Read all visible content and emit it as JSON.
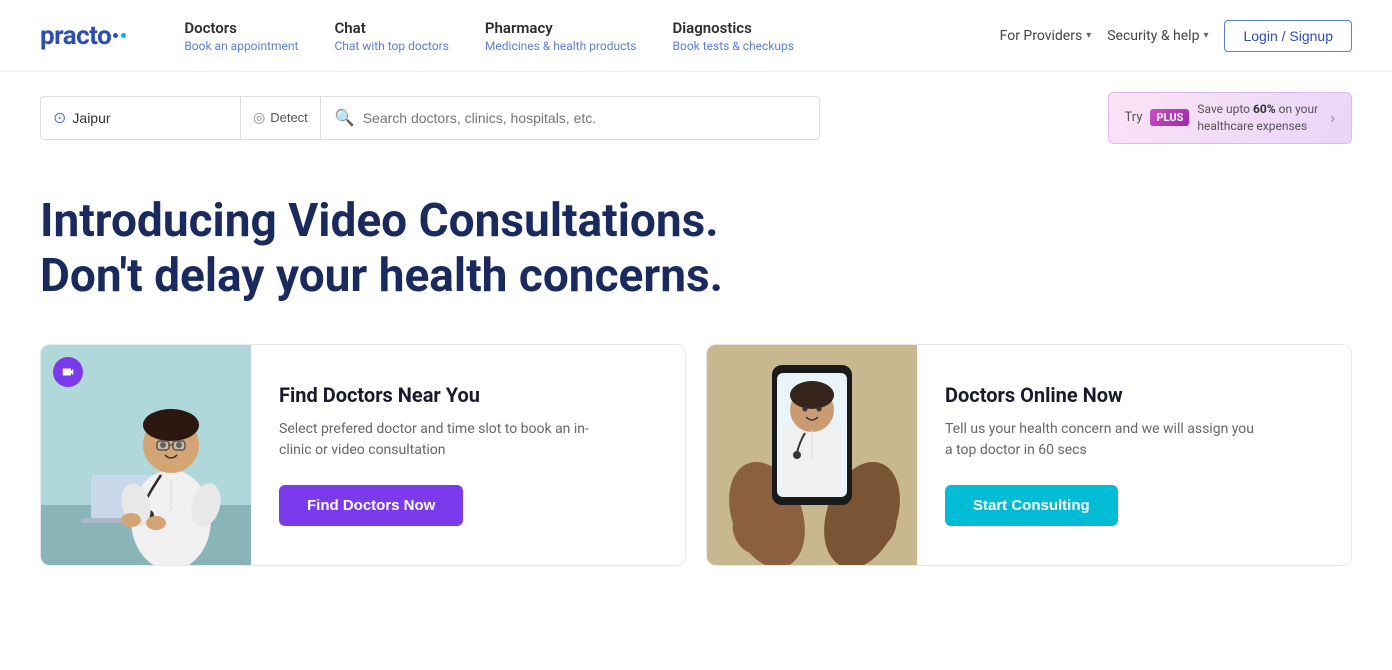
{
  "logo": {
    "text": "practo",
    "aria": "Practo Logo"
  },
  "nav": {
    "items": [
      {
        "id": "doctors",
        "main": "Doctors",
        "sub": "Book an appointment"
      },
      {
        "id": "chat",
        "main": "Chat",
        "sub": "Chat with top doctors"
      },
      {
        "id": "pharmacy",
        "main": "Pharmacy",
        "sub": "Medicines & health products"
      },
      {
        "id": "diagnostics",
        "main": "Diagnostics",
        "sub": "Book tests & checkups"
      }
    ],
    "for_providers_label": "For Providers",
    "security_label": "Security & help",
    "login_label": "Login / Signup"
  },
  "search": {
    "location_value": "Jaipur",
    "detect_label": "Detect",
    "placeholder": "Search doctors, clinics, hospitals, etc."
  },
  "plus": {
    "try_label": "Try",
    "badge_label": "PLUS",
    "desc": "Save upto 60% on your healthcare expenses"
  },
  "hero": {
    "line1": "Introducing Video Consultations.",
    "line2": "Don't delay your health concerns."
  },
  "cards": [
    {
      "id": "find-doctors",
      "title": "Find Doctors Near You",
      "description": "Select prefered doctor and time slot to book an in-clinic or video consultation",
      "button_label": "Find Doctors Now",
      "has_video_badge": true,
      "img_type": "clinic"
    },
    {
      "id": "doctors-online",
      "title": "Doctors Online Now",
      "description": "Tell us your health concern and we will assign you a top doctor in 60 secs",
      "button_label": "Start Consulting",
      "has_video_badge": false,
      "img_type": "online"
    }
  ],
  "colors": {
    "brand_blue": "#2d4db5",
    "brand_cyan": "#00bcd4",
    "brand_purple": "#7c3aed",
    "hero_text": "#1a2a5e",
    "nav_sub": "#5a7fd5"
  }
}
